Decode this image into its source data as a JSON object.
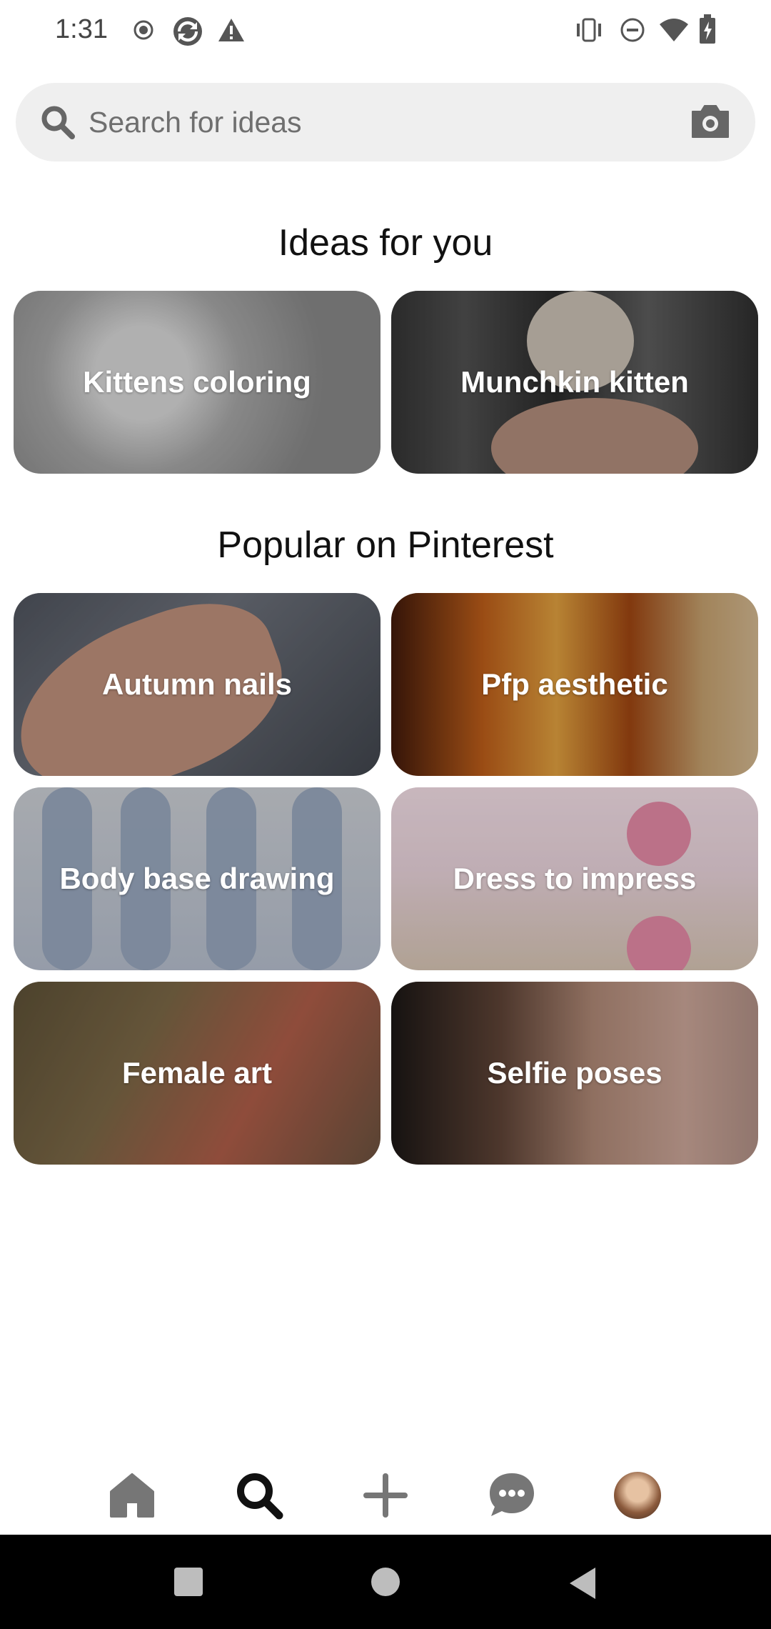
{
  "status_bar": {
    "time": "1:31",
    "left_icons": [
      "record-icon",
      "sync-icon",
      "warning-icon"
    ],
    "right_icons": [
      "vibrate-icon",
      "dnd-icon",
      "wifi-icon",
      "battery-icon"
    ]
  },
  "search": {
    "placeholder": "Search for ideas",
    "value": "",
    "camera_icon": "camera-icon"
  },
  "ideas_section": {
    "title": "Ideas for you",
    "cards": [
      {
        "label": "Kittens coloring"
      },
      {
        "label": "Munchkin kitten"
      }
    ]
  },
  "popular_section": {
    "title": "Popular on Pinterest",
    "cards": [
      {
        "label": "Autumn nails"
      },
      {
        "label": "Pfp aesthetic"
      },
      {
        "label": "Body base drawing"
      },
      {
        "label": "Dress to impress"
      },
      {
        "label": "Female art"
      },
      {
        "label": "Selfie poses"
      }
    ]
  },
  "bottom_nav": {
    "items": [
      "home-icon",
      "search-icon",
      "create-icon",
      "messages-icon",
      "profile-avatar"
    ],
    "active": "search-icon"
  },
  "system_nav": {
    "buttons": [
      "recents-button",
      "home-button",
      "back-button"
    ]
  },
  "colors": {
    "search_bg": "#efefef",
    "text_primary": "#111111",
    "text_secondary": "#6f6f6f",
    "system_nav_bg": "#000000"
  }
}
